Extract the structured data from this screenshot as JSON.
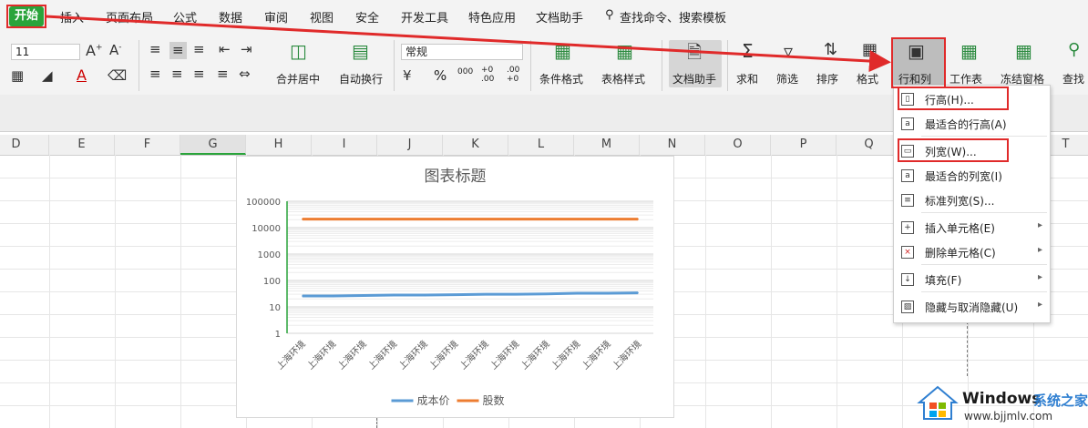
{
  "menubar": {
    "items": [
      "开始",
      "插入",
      "页面布局",
      "公式",
      "数据",
      "审阅",
      "视图",
      "安全",
      "开发工具",
      "特色应用",
      "文档助手"
    ],
    "search": "查找命令、搜索模板"
  },
  "ribbon": {
    "font_size": "11",
    "number_format": "常规",
    "labels": {
      "merge_center": "合并居中",
      "auto_wrap": "自动换行",
      "cond_format": "条件格式",
      "table_style": "表格样式",
      "doc_assist": "文档助手",
      "sum": "求和",
      "filter": "筛选",
      "sort": "排序",
      "format": "格式",
      "row_col": "行和列",
      "worksheet": "工作表",
      "freeze": "冻结窗格",
      "find": "查找"
    },
    "percent": "%",
    "thousands": "000",
    "dec_inc": "+0 .00",
    "dec_dec": ".00 +0"
  },
  "columns": [
    "D",
    "E",
    "F",
    "G",
    "H",
    "I",
    "J",
    "K",
    "L",
    "M",
    "N",
    "O",
    "P",
    "Q",
    "R",
    "S",
    "T"
  ],
  "chart_data": {
    "type": "line",
    "title": "图表标题",
    "xlabel": "",
    "ylabel": "",
    "log_scale": true,
    "ylim": [
      1,
      100000
    ],
    "y_ticks": [
      "100000",
      "10000",
      "1000",
      "100",
      "10",
      "1"
    ],
    "categories": [
      "上海环境",
      "上海环境",
      "上海环境",
      "上海环境",
      "上海环境",
      "上海环境",
      "上海环境",
      "上海环境",
      "上海环境",
      "上海环境",
      "上海环境",
      "上海环境"
    ],
    "series": [
      {
        "name": "成本价",
        "color": "#5b9bd5",
        "values": [
          26,
          26,
          27,
          28,
          28,
          29,
          30,
          30,
          31,
          33,
          33,
          34
        ]
      },
      {
        "name": "股数",
        "color": "#ed7d31",
        "values": [
          21000,
          21000,
          21000,
          21000,
          21000,
          21000,
          21000,
          21000,
          21000,
          21000,
          21000,
          21000
        ]
      }
    ],
    "legend_position": "bottom",
    "grid": true
  },
  "context_menu": {
    "items": [
      {
        "label": "行高(H)...",
        "icon": "row-height-icon",
        "submenu": false
      },
      {
        "label": "最适合的行高(A)",
        "icon": "autofit-row-icon",
        "submenu": false
      },
      {
        "label": "列宽(W)...",
        "icon": "col-width-icon",
        "submenu": false
      },
      {
        "label": "最适合的列宽(I)",
        "icon": "autofit-col-icon",
        "submenu": false
      },
      {
        "label": "标准列宽(S)...",
        "icon": "standard-width-icon",
        "submenu": false
      },
      {
        "label": "插入单元格(E)",
        "icon": "insert-cell-icon",
        "submenu": true
      },
      {
        "label": "删除单元格(C)",
        "icon": "delete-cell-icon",
        "submenu": true
      },
      {
        "label": "填充(F)",
        "icon": "fill-icon",
        "submenu": true
      },
      {
        "label": "隐藏与取消隐藏(U)",
        "icon": "hide-unhide-icon",
        "submenu": true
      }
    ]
  },
  "watermark": {
    "brand": "Windows",
    "cn": "系统之家",
    "url": "www.bjjmlv.com"
  },
  "colors": {
    "accent_green": "#2aa43b",
    "annotation_red": "#e02a2a"
  }
}
